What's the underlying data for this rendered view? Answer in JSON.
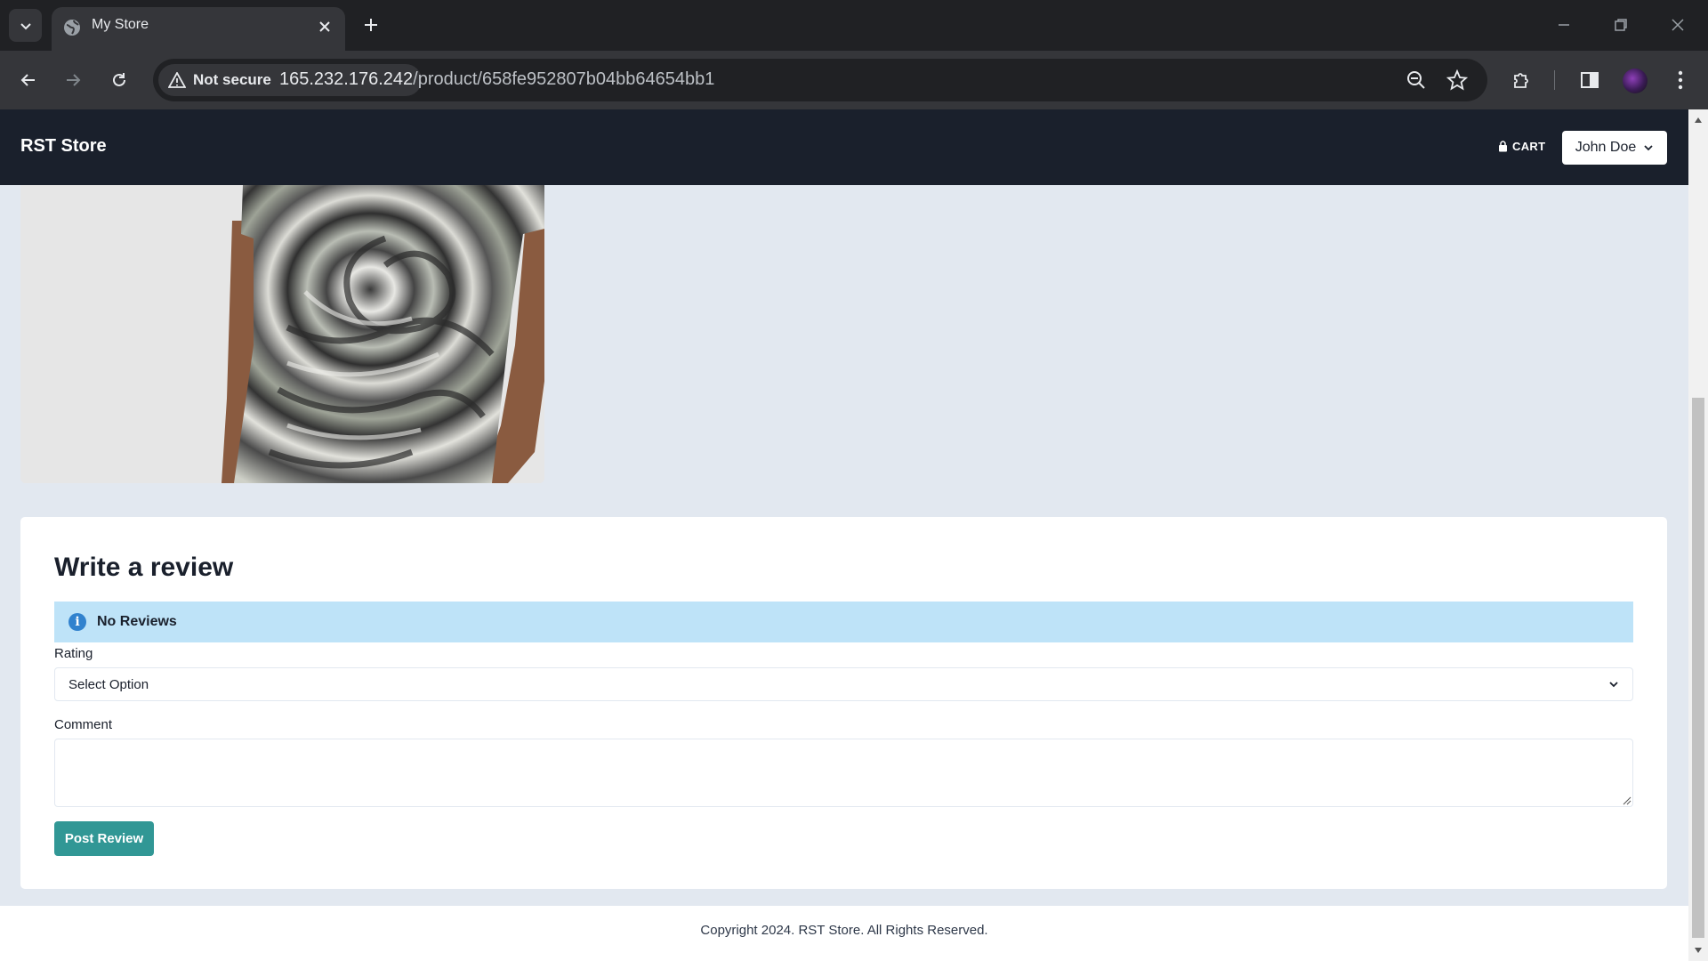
{
  "browser": {
    "tab_title": "My Store",
    "security_label": "Not secure",
    "url_host": "165.232.176.242",
    "url_path": "/product/658fe952807b04bb64654bb1"
  },
  "header": {
    "brand": "RST Store",
    "cart_label": "CART",
    "user_name": "John Doe"
  },
  "review": {
    "title": "Write a review",
    "alert_text": "No Reviews",
    "rating_label": "Rating",
    "rating_selected": "Select Option",
    "comment_label": "Comment",
    "comment_value": "",
    "submit_label": "Post Review"
  },
  "footer": {
    "copyright": "Copyright 2024. RST Store. All Rights Reserved."
  },
  "colors": {
    "navbar_bg": "#1a202c",
    "page_bg": "#e2e8f0",
    "alert_bg": "#bee3f8",
    "button_bg": "#319795"
  }
}
